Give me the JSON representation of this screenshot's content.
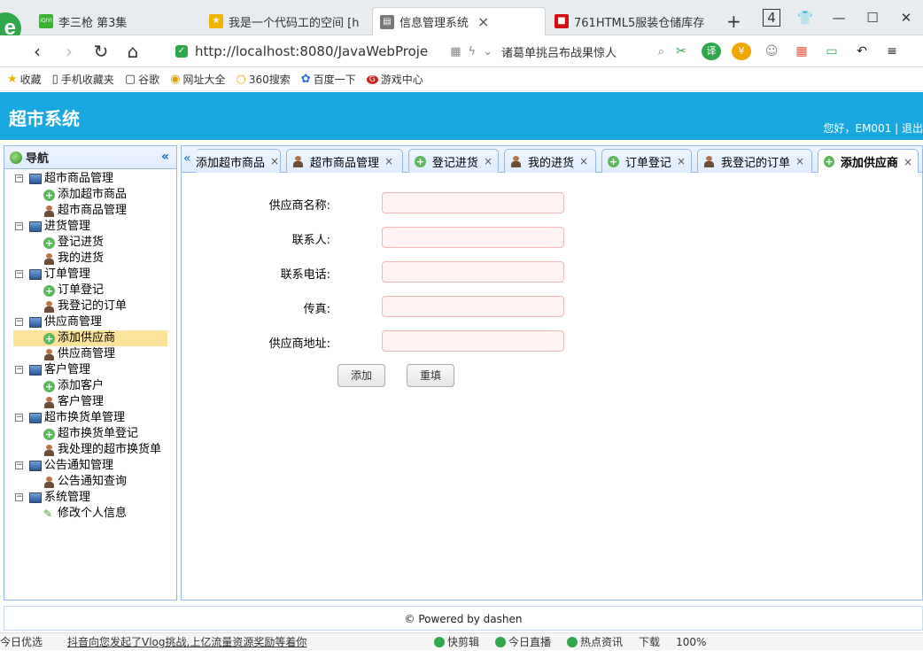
{
  "browser": {
    "logo_glyph": "e",
    "tabs": [
      {
        "title": "李三枪 第3集",
        "favicon": "iQIYI",
        "favicon_color": "#3bb233",
        "active": false
      },
      {
        "title": "我是一个代码工的空间 [h",
        "favicon": "★",
        "favicon_color": "#f0b400",
        "active": false
      },
      {
        "title": "信息管理系统",
        "favicon": "▤",
        "favicon_color": "#777777",
        "active": true
      },
      {
        "title": "761HTML5服装仓储库存",
        "favicon": "■",
        "favicon_color": "#d01010",
        "active": false
      }
    ],
    "new_tab": "+",
    "window_controls": {
      "tab_count": "4",
      "shirt": "👕",
      "minimize": "—",
      "maximize": "☐",
      "close": "✕"
    },
    "url": "http://localhost:8080/JavaWebProje",
    "search_query": "诸葛单挑吕布战果惊人",
    "bookmarks": [
      {
        "label": "收藏",
        "icon": "★"
      },
      {
        "label": "手机收藏夹",
        "icon": "▯"
      },
      {
        "label": "谷歌",
        "icon": "▢"
      },
      {
        "label": "网址大全",
        "icon": "◉"
      },
      {
        "label": "360搜索",
        "icon": "○"
      },
      {
        "label": "百度一下",
        "icon": "✿"
      },
      {
        "label": "游戏中心",
        "icon": "G"
      }
    ]
  },
  "app": {
    "title": "超市系统",
    "user_info": "您好，EM001 | 退出",
    "nav_title": "导航",
    "tree": [
      {
        "label": "超市商品管理",
        "type": "folder",
        "children": [
          {
            "label": "添加超市商品",
            "icon": "add"
          },
          {
            "label": "超市商品管理",
            "icon": "person"
          }
        ]
      },
      {
        "label": "进货管理",
        "type": "folder",
        "children": [
          {
            "label": "登记进货",
            "icon": "add"
          },
          {
            "label": "我的进货",
            "icon": "person"
          }
        ]
      },
      {
        "label": "订单管理",
        "type": "folder",
        "children": [
          {
            "label": "订单登记",
            "icon": "add"
          },
          {
            "label": "我登记的订单",
            "icon": "person"
          }
        ]
      },
      {
        "label": "供应商管理",
        "type": "folder",
        "children": [
          {
            "label": "添加供应商",
            "icon": "add",
            "selected": true
          },
          {
            "label": "供应商管理",
            "icon": "person"
          }
        ]
      },
      {
        "label": "客户管理",
        "type": "folder",
        "children": [
          {
            "label": "添加客户",
            "icon": "add"
          },
          {
            "label": "客户管理",
            "icon": "person"
          }
        ]
      },
      {
        "label": "超市换货单管理",
        "type": "folder",
        "children": [
          {
            "label": "超市换货单登记",
            "icon": "add"
          },
          {
            "label": "我处理的超市换货单",
            "icon": "person"
          }
        ]
      },
      {
        "label": "公告通知管理",
        "type": "folder",
        "children": [
          {
            "label": "公告通知查询",
            "icon": "person"
          }
        ]
      },
      {
        "label": "系统管理",
        "type": "folder",
        "children": [
          {
            "label": "修改个人信息",
            "icon": "pencil"
          }
        ]
      }
    ],
    "page_tabs": [
      {
        "label": "添加超市商品",
        "icon": "none",
        "active": false
      },
      {
        "label": "超市商品管理",
        "icon": "person",
        "active": false
      },
      {
        "label": "登记进货",
        "icon": "add",
        "active": false
      },
      {
        "label": "我的进货",
        "icon": "person",
        "active": false
      },
      {
        "label": "订单登记",
        "icon": "add",
        "active": false
      },
      {
        "label": "我登记的订单",
        "icon": "person",
        "active": false
      },
      {
        "label": "添加供应商",
        "icon": "add",
        "active": true
      }
    ],
    "form": {
      "fields": [
        {
          "label": "供应商名称:",
          "value": ""
        },
        {
          "label": "联系人:",
          "value": ""
        },
        {
          "label": "联系电话:",
          "value": ""
        },
        {
          "label": "传真:",
          "value": ""
        },
        {
          "label": "供应商地址:",
          "value": ""
        }
      ],
      "submit_label": "添加",
      "reset_label": "重填"
    },
    "footer": "© Powered by dashen"
  },
  "statusbar": {
    "left": "今日优选",
    "news": "抖音向您发起了Vlog挑战,上亿流量资源奖励等着你",
    "items": [
      "快剪辑",
      "今日直播",
      "热点资讯",
      "下载",
      "100%"
    ]
  }
}
